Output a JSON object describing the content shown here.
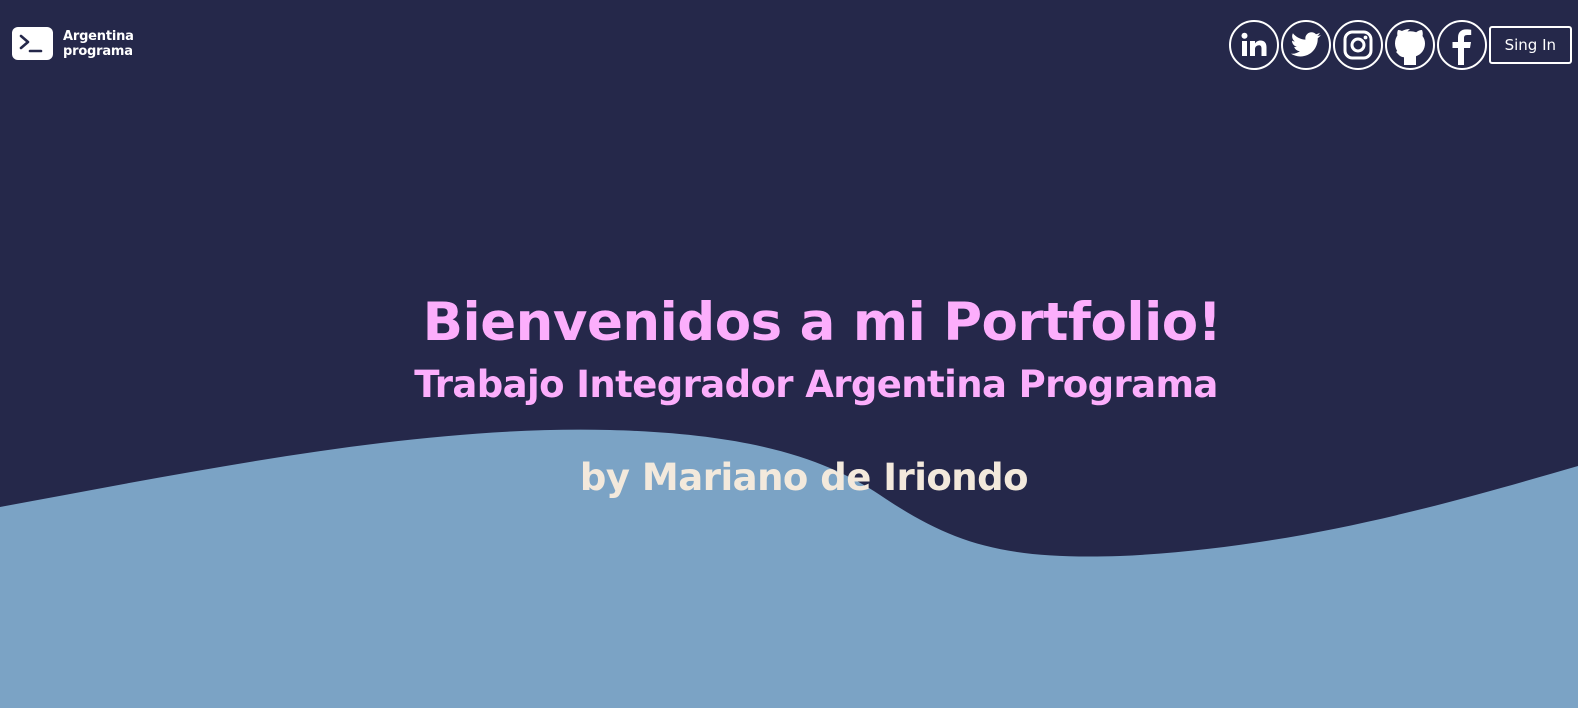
{
  "brand": {
    "line1": "Argentina",
    "line2": "programa"
  },
  "nav": {
    "social": [
      {
        "name": "linkedin",
        "icon": "linkedin-icon"
      },
      {
        "name": "twitter",
        "icon": "twitter-icon"
      },
      {
        "name": "instagram",
        "icon": "instagram-icon"
      },
      {
        "name": "github",
        "icon": "github-icon"
      },
      {
        "name": "facebook",
        "icon": "facebook-icon"
      }
    ],
    "signin_label": "Sing In"
  },
  "hero": {
    "title": "Bienvenidos a mi Portfolio!",
    "subtitle": "Trabajo Integrador Argentina Programa",
    "author": "by Mariano de Iriondo"
  },
  "colors": {
    "background": "#25284a",
    "wave": "#7ba3c5",
    "accent_pink": "#fcaefc",
    "author_cream": "#f3e9dc",
    "white": "#ffffff"
  }
}
